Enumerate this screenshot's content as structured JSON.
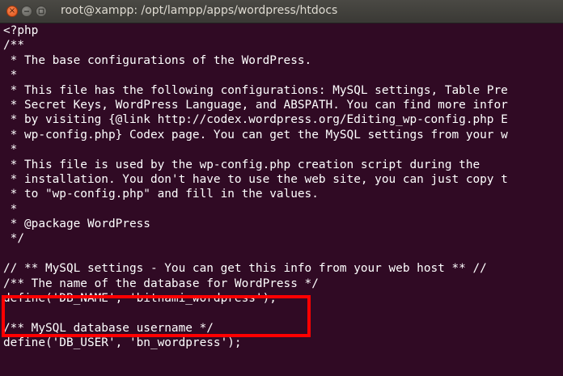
{
  "window": {
    "title": "root@xampp: /opt/lampp/apps/wordpress/htdocs",
    "close_glyph": "×"
  },
  "terminal": {
    "lines": [
      "<?php",
      "/**",
      " * The base configurations of the WordPress.",
      " *",
      " * This file has the following configurations: MySQL settings, Table Pre",
      " * Secret Keys, WordPress Language, and ABSPATH. You can find more infor",
      " * by visiting {@link http://codex.wordpress.org/Editing_wp-config.php E",
      " * wp-config.php} Codex page. You can get the MySQL settings from your w",
      " *",
      " * This file is used by the wp-config.php creation script during the",
      " * installation. You don't have to use the web site, you can just copy t",
      " * to \"wp-config.php\" and fill in the values.",
      " *",
      " * @package WordPress",
      " */",
      "",
      "// ** MySQL settings - You can get this info from your web host ** //",
      "/** The name of the database for WordPress */",
      "define('DB_NAME', 'bitnami_wordpress');",
      "",
      "/** MySQL database username */",
      "define('DB_USER', 'bn_wordpress');"
    ]
  },
  "colors": {
    "terminal_background": "#300a24",
    "terminal_text": "#ffffff",
    "highlight_border": "#ff0000",
    "close_button": "#e95420"
  }
}
